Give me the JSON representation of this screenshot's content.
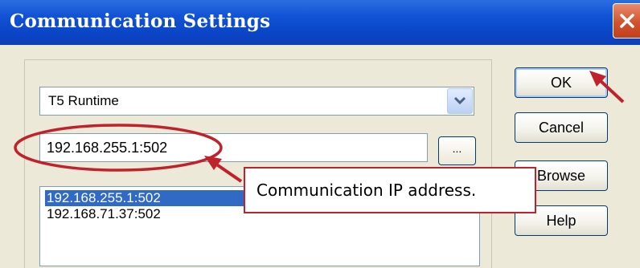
{
  "window": {
    "title": "Communication Settings"
  },
  "driver_select": {
    "selected": "T5 Runtime"
  },
  "address_field": {
    "value": "192.168.255.1:502"
  },
  "browse_dots_label": "...",
  "recent_addresses": [
    "192.168.255.1:502",
    "192.168.71.37:502"
  ],
  "buttons": {
    "ok": "OK",
    "cancel": "Cancel",
    "browse": "Browse",
    "help": "Help"
  },
  "annotation": {
    "text": "Communication IP address.",
    "color": "#c0222b"
  },
  "colors": {
    "titlebar": "#0a46c8",
    "selection": "#316ac5",
    "dialog_bg": "#ece9d8",
    "close": "#d2532f"
  }
}
